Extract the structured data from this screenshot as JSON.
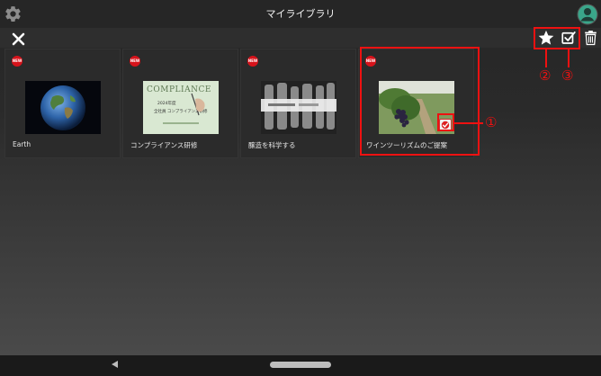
{
  "app": {
    "title": "マイライブラリ"
  },
  "header": {
    "settings_icon": "gear-icon",
    "account_icon": "account-icon"
  },
  "toolbar": {
    "close_icon": "close-icon",
    "favorite_icon": "star-icon",
    "select_icon": "checkbox-icon",
    "delete_icon": "trash-icon"
  },
  "items": [
    {
      "badge": "NEW",
      "label": "Earth"
    },
    {
      "badge": "NEW",
      "label": "コンプライアンス研修",
      "thumb_title": "COMPLIANCE",
      "thumb_line1": "2024年度",
      "thumb_line2": "全社員 コンプライアンス研修"
    },
    {
      "badge": "NEW",
      "label": "醸造を科学する"
    },
    {
      "badge": "NEW",
      "label": "ワインツーリズムのご提案"
    }
  ],
  "annotations": {
    "one": "①",
    "two": "②",
    "three": "③"
  },
  "navbar": {
    "back_icon": "back-icon"
  },
  "colors": {
    "accent_red": "#ee1111",
    "new_badge": "#d7131b",
    "avatar_green": "#3aa68a"
  }
}
